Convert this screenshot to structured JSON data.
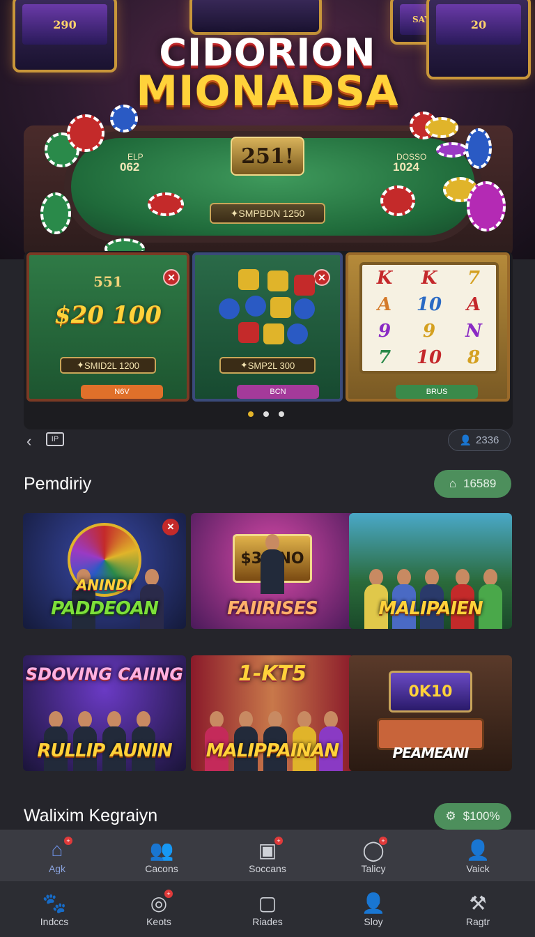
{
  "hero": {
    "title_line1": "CIDORION",
    "title_line2": "MIONADSA",
    "badge": "251",
    "left_label": "ELP",
    "left_value": "062",
    "right_label": "DOSSO",
    "right_value": "1024",
    "plate_text": "SMPBDN 1250",
    "machines": [
      "290",
      "20",
      "SAY"
    ]
  },
  "carousel": {
    "cards": [
      {
        "badge": "551",
        "big": "$20 100",
        "plate": "SMID2L 1200",
        "pill": "N6V",
        "pill_color": "#e0702a"
      },
      {
        "plate": "SMP2L 300",
        "pill": "BCN",
        "pill_color": "#a43a9a"
      },
      {
        "pill": "BRUS",
        "pill_color": "#3a8a4a",
        "reel": [
          "K",
          "K",
          "7",
          "A",
          "10",
          "A",
          "9",
          "9",
          "N",
          "7",
          "10",
          "8"
        ]
      }
    ],
    "dots": 3,
    "active_dot": 0
  },
  "subrow": {
    "back_icon": "chevron-left-icon",
    "tag_label": "IP",
    "user_count": "2336"
  },
  "section1": {
    "title": "Pemdiriy",
    "pill_icon": "home-icon",
    "pill_value": "16589"
  },
  "games": [
    {
      "title": "PADDEOAN",
      "headline": "ANINDI",
      "style": "green"
    },
    {
      "title": "FAIIRISES",
      "frame": "$30INO",
      "style": "pink"
    },
    {
      "title": "MALIPAIEN",
      "style": "yellow"
    },
    {
      "title": "RULLIP AUNIN",
      "headline": "SDOVING CAIING",
      "style": "yellow"
    },
    {
      "title": "MALIPPAINAN",
      "headline": "1-KT5",
      "style": "yellow"
    },
    {
      "title": "PEAMEANI",
      "frame": "0K10",
      "style": "yellow"
    }
  ],
  "section2": {
    "title": "Walixim Kegraiyn",
    "pill_icon": "gear-icon",
    "pill_value": "$100%"
  },
  "nav_top": [
    {
      "label": "Agk",
      "icon": "home-icon",
      "active": true,
      "badge": true
    },
    {
      "label": "Cacons",
      "icon": "group-icon",
      "badge": false
    },
    {
      "label": "Soccans",
      "icon": "briefcase-icon",
      "badge": true
    },
    {
      "label": "Talicy",
      "icon": "refresh-icon",
      "badge": true
    },
    {
      "label": "Vaick",
      "icon": "user-icon",
      "badge": false
    }
  ],
  "nav_bottom": [
    {
      "label": "Indccs",
      "icon": "paw-icon",
      "badge": false
    },
    {
      "label": "Keots",
      "icon": "compass-icon",
      "badge": true
    },
    {
      "label": "Riades",
      "icon": "camera-icon",
      "badge": false
    },
    {
      "label": "Sloy",
      "icon": "person-icon",
      "badge": false
    },
    {
      "label": "Ragtr",
      "icon": "tools-icon",
      "badge": false
    }
  ],
  "colors": {
    "background": "#25252b",
    "accent_green": "#4d8f5c",
    "active_nav": "#6a8cdc",
    "gold": "#ffd23a"
  }
}
